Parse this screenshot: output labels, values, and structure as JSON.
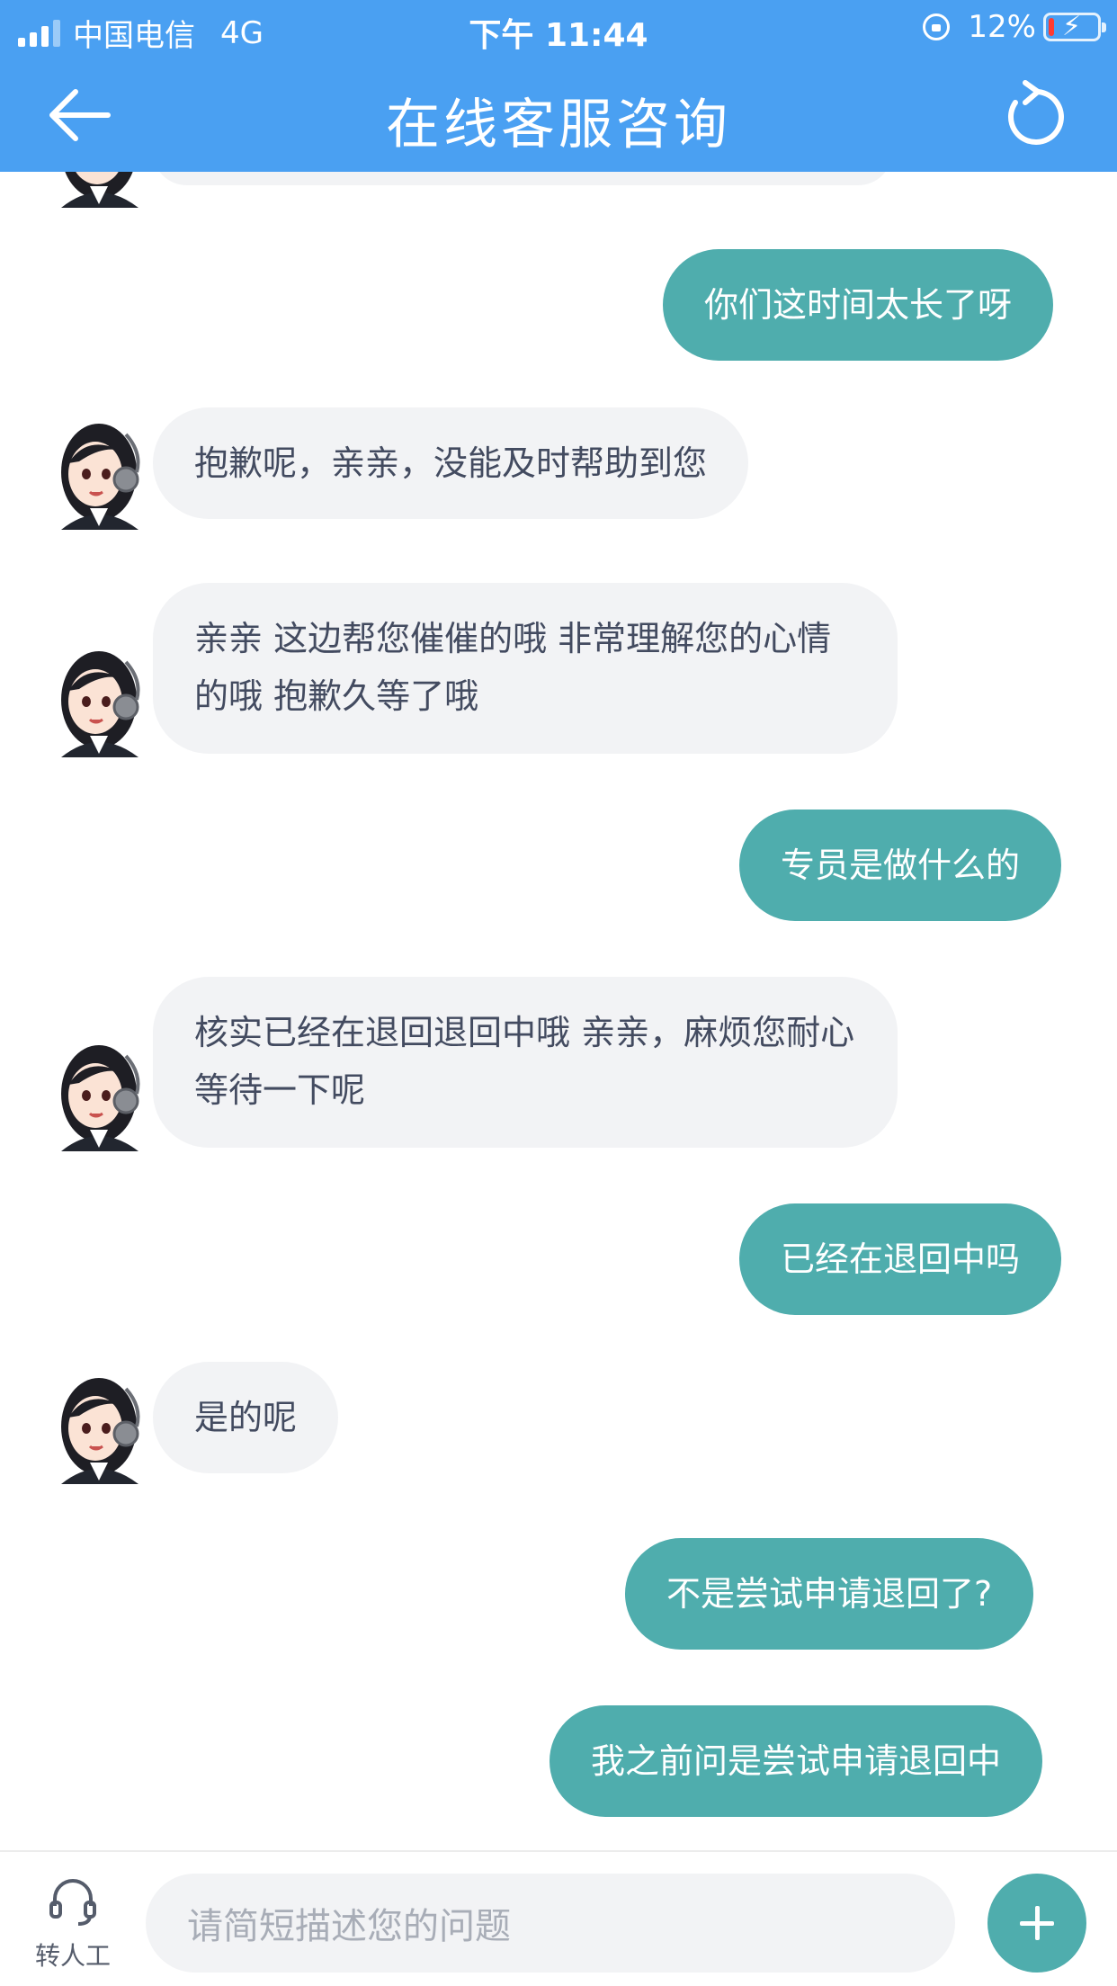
{
  "status_bar": {
    "carrier": "中国电信",
    "network": "4G",
    "time": "下午 11:44",
    "battery_percent_label": "12%",
    "battery_level": 0.12
  },
  "header": {
    "title": "在线客服咨询",
    "back_icon": "arrow-left-icon",
    "refresh_icon": "refresh-icon"
  },
  "colors": {
    "header_bg": "#4aa0f2",
    "user_bubble": "#4fadad",
    "agent_bubble": "#f2f3f5",
    "battery_low": "#ff3b30"
  },
  "messages": [
    {
      "sender": "user",
      "text": "你们这时间太长了呀"
    },
    {
      "sender": "agent",
      "text": "抱歉呢，亲亲，没能及时帮助到您"
    },
    {
      "sender": "agent",
      "text": "亲亲 这边帮您催催的哦 非常理解您的心情的哦 抱歉久等了哦"
    },
    {
      "sender": "user",
      "text": "专员是做什么的"
    },
    {
      "sender": "agent",
      "text": "核实已经在退回退回中哦 亲亲，麻烦您耐心等待一下呢"
    },
    {
      "sender": "user",
      "text": "已经在退回中吗"
    },
    {
      "sender": "agent",
      "text": "是的呢"
    },
    {
      "sender": "user",
      "text": "不是尝试申请退回了?"
    },
    {
      "sender": "user",
      "text": "我之前问是尝试申请退回中"
    }
  ],
  "bottom_bar": {
    "human_label": "转人工",
    "human_icon": "headset-icon",
    "input_placeholder": "请简短描述您的问题",
    "plus_icon": "plus-icon"
  }
}
